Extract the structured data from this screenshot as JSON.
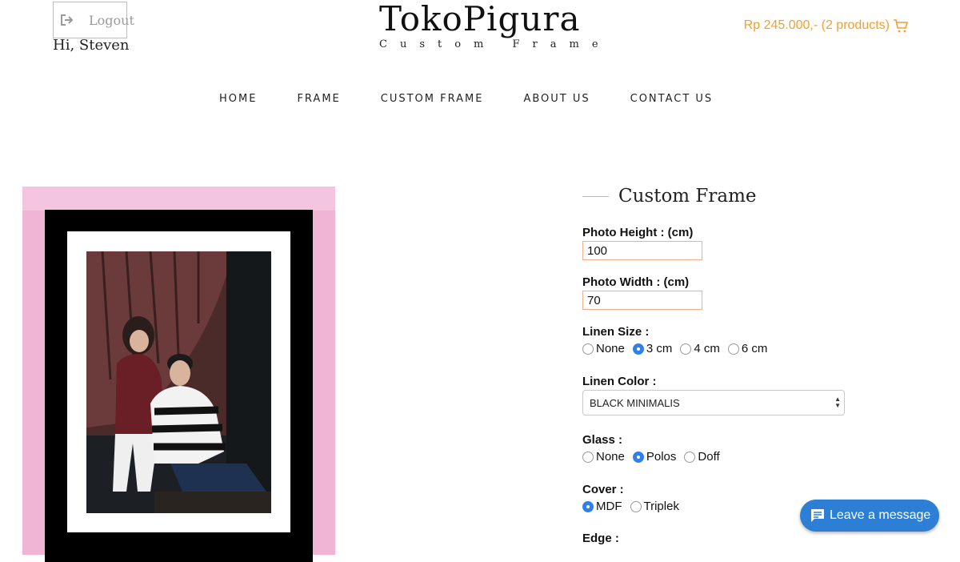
{
  "header": {
    "logout_label": "Logout",
    "greeting": "Hi, Steven",
    "brand_name": "TokoPigura",
    "brand_sub": "Custom Frame",
    "cart_text": "Rp 245.000,- (2 products)"
  },
  "nav": [
    "HOME",
    "FRAME",
    "CUSTOM FRAME",
    "ABOUT US",
    "CONTACT US"
  ],
  "form": {
    "title": "Custom Frame",
    "photo_height_label": "Photo Height : (cm)",
    "photo_height_value": "100",
    "photo_width_label": "Photo Width : (cm)",
    "photo_width_value": "70",
    "linen_size_label": "Linen Size :",
    "linen_size_options": [
      "None",
      "3 cm",
      "4 cm",
      "6 cm"
    ],
    "linen_size_selected": "3 cm",
    "linen_color_label": "Linen Color :",
    "linen_color_value": "BLACK MINIMALIS",
    "glass_label": "Glass :",
    "glass_options": [
      "None",
      "Polos",
      "Doff"
    ],
    "glass_selected": "Polos",
    "cover_label": "Cover :",
    "cover_options": [
      "MDF",
      "Triplek"
    ],
    "cover_selected": "MDF",
    "edge_label": "Edge :"
  },
  "chat": {
    "label": "Leave a message"
  },
  "colors": {
    "accent": "#f0a030",
    "frame": "#f0b4d4",
    "chat": "#2d7fd6",
    "radio": "#2f80ed"
  }
}
